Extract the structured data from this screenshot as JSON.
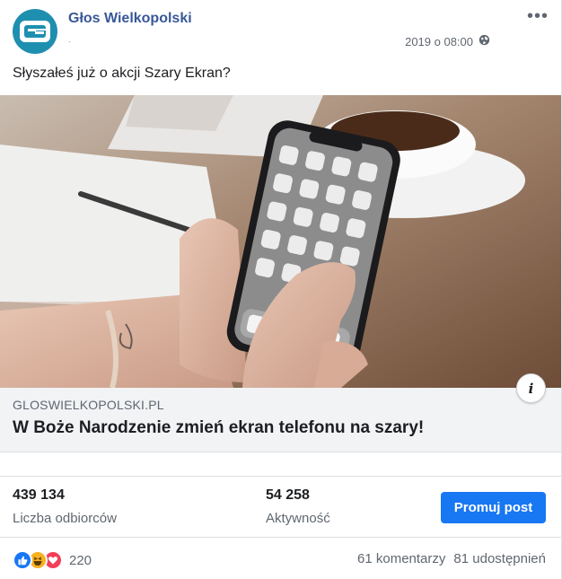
{
  "post": {
    "page_name": "Głos Wielkopolski",
    "timestamp": "2019 o 08:00",
    "visibility_icon": "globe-icon",
    "text": "Słyszałeś już o akcji Szary Ekran?"
  },
  "link": {
    "domain": "GLOSWIELKOPOLSKI.PL",
    "title": "W Boże Narodzenie zmień ekran telefonu na szary!"
  },
  "stats": {
    "reach_value": "439 134",
    "reach_label": "Liczba odbiorców",
    "engagement_value": "54 258",
    "engagement_label": "Aktywność",
    "promote_label": "Promuj post"
  },
  "reactions": {
    "types": [
      "like",
      "haha",
      "love"
    ],
    "count": "220",
    "comments": "61 komentarzy",
    "shares": "81 udostępnień"
  },
  "colors": {
    "brand_blue": "#1877f2",
    "name_blue": "#385898",
    "avatar_teal": "#1f8fb0"
  }
}
